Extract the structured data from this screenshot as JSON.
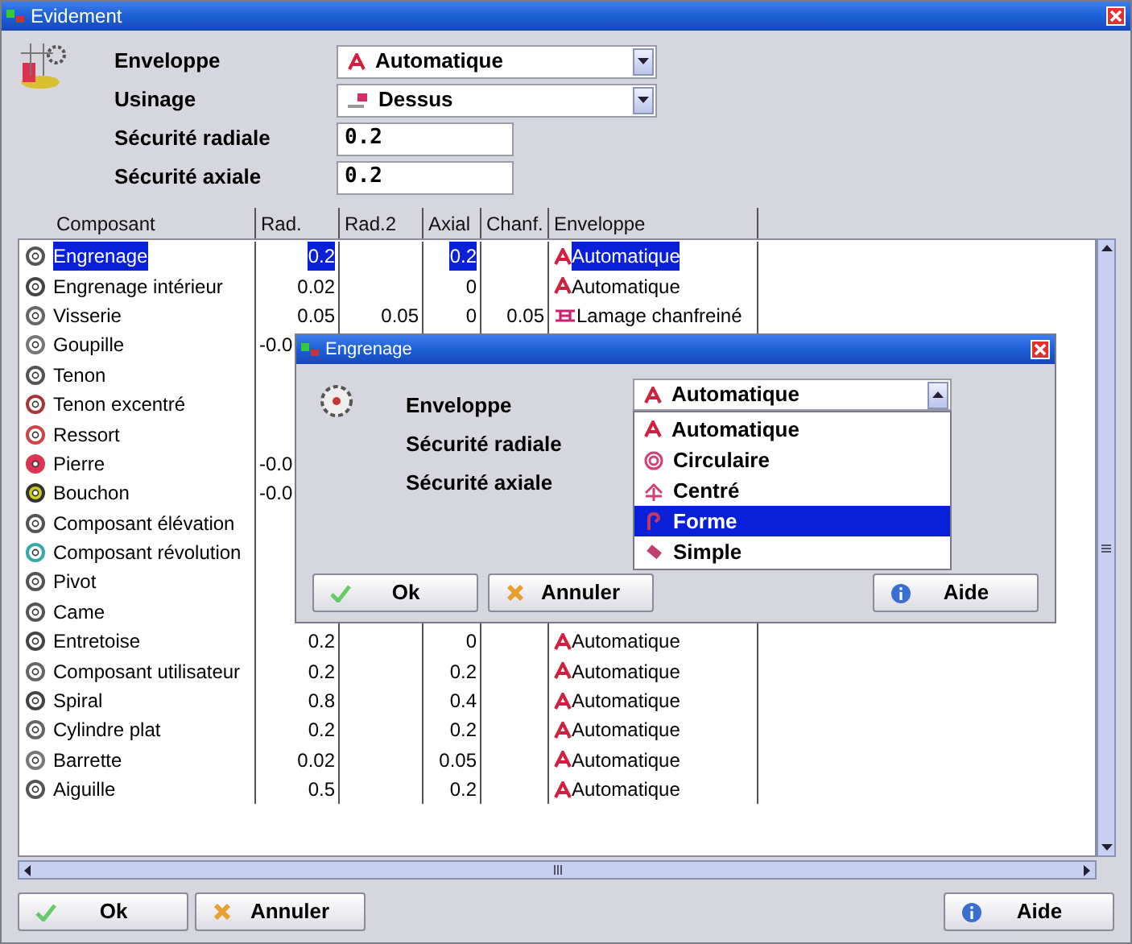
{
  "window": {
    "title": "Evidement"
  },
  "form": {
    "fields": [
      {
        "kind": "combo",
        "label": "Enveloppe",
        "value": "Automatique"
      },
      {
        "kind": "combo",
        "label": "Usinage",
        "value": "Dessus"
      },
      {
        "kind": "text",
        "label": "Sécurité radiale",
        "value": "0.2"
      },
      {
        "kind": "text",
        "label": "Sécurité axiale",
        "value": "0.2"
      }
    ]
  },
  "table": {
    "columns": [
      "Composant",
      "Rad.",
      "Rad.2",
      "Axial",
      "Chanf.",
      "Enveloppe"
    ],
    "rows": [
      {
        "name": "Engrenage",
        "rad": "0.2",
        "axial": "0.2",
        "envelope": "Automatique",
        "selected": true
      },
      {
        "name": "Engrenage intérieur",
        "rad": "0.02",
        "axial": "0",
        "envelope": "Automatique",
        "selected": false
      },
      {
        "name": "Visserie",
        "rad": "0.05",
        "rad2": "0.05",
        "axial": "0",
        "chanf": "0.05",
        "envelope": "Lamage chanfreiné",
        "selected": false
      },
      {
        "name": "Goupille",
        "rad": "-0.0",
        "selected": false
      },
      {
        "name": "Tenon",
        "selected": false
      },
      {
        "name": "Tenon excentré",
        "selected": false
      },
      {
        "name": "Ressort",
        "selected": false
      },
      {
        "name": "Pierre",
        "rad": "-0.0",
        "selected": false
      },
      {
        "name": "Bouchon",
        "rad": "-0.0",
        "selected": false
      },
      {
        "name": "Composant élévation",
        "selected": false
      },
      {
        "name": "Composant révolution",
        "selected": false
      },
      {
        "name": "Pivot",
        "selected": false
      },
      {
        "name": "Came",
        "selected": false
      },
      {
        "name": "Entretoise",
        "rad": "0.2",
        "axial": "0",
        "envelope": "Automatique",
        "selected": false
      },
      {
        "name": "Composant utilisateur",
        "rad": "0.2",
        "axial": "0.2",
        "envelope": "Automatique",
        "selected": false
      },
      {
        "name": "Spiral",
        "rad": "0.8",
        "axial": "0.4",
        "envelope": "Automatique",
        "selected": false
      },
      {
        "name": "Cylindre plat",
        "rad": "0.2",
        "axial": "0.2",
        "envelope": "Automatique",
        "selected": false
      },
      {
        "name": "Barrette",
        "rad": "0.02",
        "axial": "0.05",
        "envelope": "Automatique",
        "selected": false
      },
      {
        "name": "Aiguille",
        "rad": "0.5",
        "axial": "0.2",
        "envelope": "Automatique",
        "selected": false
      }
    ]
  },
  "dialog": {
    "title": "Engrenage",
    "labels": [
      "Enveloppe",
      "Sécurité radiale",
      "Sécurité axiale"
    ],
    "combo": {
      "value": "Automatique",
      "expanded": true
    },
    "options": [
      {
        "label": "Automatique",
        "selected": false
      },
      {
        "label": "Circulaire",
        "selected": false
      },
      {
        "label": "Centré",
        "selected": false
      },
      {
        "label": "Forme",
        "selected": true
      },
      {
        "label": "Simple",
        "selected": false
      }
    ],
    "buttons": [
      "Ok",
      "Annuler",
      "Aide"
    ]
  },
  "buttons": [
    "Ok",
    "Annuler",
    "Aide"
  ]
}
